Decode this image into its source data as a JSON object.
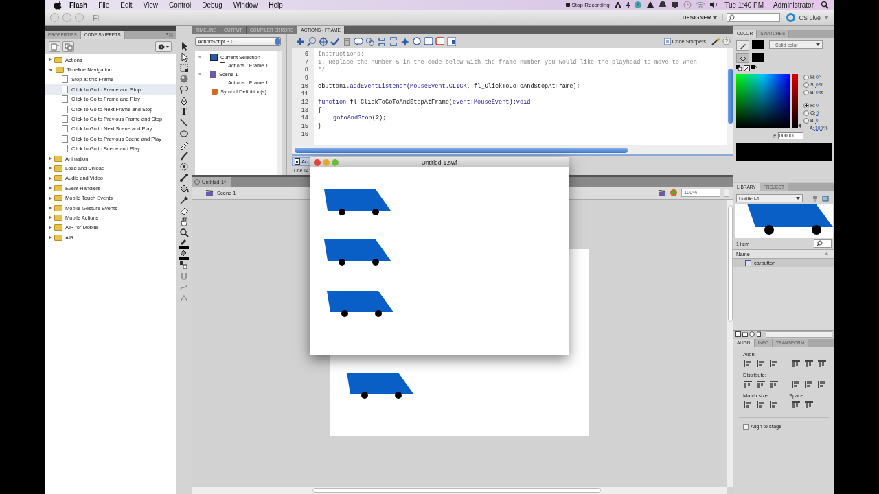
{
  "menu_bar": {
    "app": "Flash",
    "items": [
      "File",
      "Edit",
      "View",
      "Control",
      "Debug",
      "Window",
      "Help"
    ],
    "recording": "Stop Recording",
    "adobe_count": "4",
    "clock": "Tue 1:40 PM",
    "user": "Administrator"
  },
  "title_bar": {
    "logo": "Fl",
    "workspace": "DESIGNER",
    "cs_live": "CS Live"
  },
  "left_panel": {
    "tabs": [
      {
        "label": "PROPERTIES",
        "selected": false
      },
      {
        "label": "CODE SNIPPETS",
        "selected": true
      }
    ],
    "tree": [
      {
        "label": "Actions",
        "expanded": false,
        "selected": false
      },
      {
        "label": "Timeline Navigation",
        "expanded": true,
        "selected": false,
        "children": [
          {
            "label": "Stop at this Frame",
            "selected": false
          },
          {
            "label": "Click to Go to Frame and Stop",
            "selected": true
          },
          {
            "label": "Click to Go to Frame and Play",
            "selected": false
          },
          {
            "label": "Click to Go to Next Frame and Stop",
            "selected": false
          },
          {
            "label": "Click to Go to Previous Frame and Stop",
            "selected": false
          },
          {
            "label": "Click to Go to Next Scene and Play",
            "selected": false
          },
          {
            "label": "Click to Go to Previous Scene and Play",
            "selected": false
          },
          {
            "label": "Click to Go to Scene and Play",
            "selected": false
          }
        ]
      },
      {
        "label": "Animation",
        "expanded": false,
        "selected": false
      },
      {
        "label": "Load and Unload",
        "expanded": false,
        "selected": false
      },
      {
        "label": "Audio and Video",
        "expanded": false,
        "selected": false
      },
      {
        "label": "Event Handlers",
        "expanded": false,
        "selected": false
      },
      {
        "label": "Mobile Touch Events",
        "expanded": false,
        "selected": false
      },
      {
        "label": "Mobile Gesture Events",
        "expanded": false,
        "selected": false
      },
      {
        "label": "Mobile Actions",
        "expanded": false,
        "selected": false
      },
      {
        "label": "AIR for Mobile",
        "expanded": false,
        "selected": false
      },
      {
        "label": "AIR",
        "expanded": false,
        "selected": false
      }
    ]
  },
  "tools": {
    "text_tool_glyph": "T"
  },
  "actions_panel": {
    "tabs": [
      {
        "label": "TIMELINE",
        "selected": false
      },
      {
        "label": "OUTPUT",
        "selected": false
      },
      {
        "label": "COMPILER ERRORS",
        "selected": false
      },
      {
        "label": "ACTIONS - FRAME",
        "selected": true
      }
    ],
    "language": "ActionScript 3.0",
    "navigator": [
      {
        "label": "Current Selection",
        "kind": "selection",
        "expanded": true,
        "children": [
          {
            "label": "Actions : Frame 1"
          }
        ]
      },
      {
        "label": "Scene 1",
        "kind": "scene",
        "expanded": true,
        "children": [
          {
            "label": "Actions : Frame 1"
          }
        ]
      },
      {
        "label": "Symbol Definition(s)",
        "kind": "symbols"
      }
    ],
    "code_snippets_button": "Code Snippets",
    "code_lines": [
      {
        "number": "6",
        "tokens": [
          {
            "text": "Instructions:",
            "kind": "comment"
          }
        ]
      },
      {
        "number": "7",
        "tokens": [
          {
            "text": "1. Replace the number 5 in the code below with the frame number you would like the playhead to move to when",
            "kind": "comment"
          }
        ]
      },
      {
        "number": "8",
        "tokens": [
          {
            "text": "*/",
            "kind": "comment"
          }
        ]
      },
      {
        "number": "9"
      },
      {
        "number": "10",
        "tokens": [
          {
            "text": "cbutton1.",
            "kind": "plain"
          },
          {
            "text": "addEventListener",
            "kind": "keyword"
          },
          {
            "text": "(",
            "kind": "plain"
          },
          {
            "text": "MouseEvent.CLICK",
            "kind": "keyword"
          },
          {
            "text": ", fl_ClickToGoToAndStopAtFrame);",
            "kind": "plain"
          }
        ]
      },
      {
        "number": "11"
      },
      {
        "number": "12",
        "tokens": [
          {
            "text": "function",
            "kind": "keyword"
          },
          {
            "text": " fl_ClickToGoToAndStopAtFrame(",
            "kind": "plain"
          },
          {
            "text": "event:MouseEvent",
            "kind": "keyword"
          },
          {
            "text": "):",
            "kind": "plain"
          },
          {
            "text": "void",
            "kind": "keyword"
          }
        ]
      },
      {
        "number": "13",
        "tokens": [
          {
            "text": "{",
            "kind": "plain"
          }
        ]
      },
      {
        "number": "14",
        "indented": true,
        "tokens": [
          {
            "text": "gotoAndStop",
            "kind": "keyword"
          },
          {
            "text": "(2);",
            "kind": "plain"
          }
        ]
      },
      {
        "number": "15",
        "tokens": [
          {
            "text": "}",
            "kind": "plain"
          }
        ]
      },
      {
        "number": "16"
      }
    ],
    "bottom_tab": "Act",
    "status": "Line 14"
  },
  "document": {
    "tab": "Untitled-1*",
    "scene": "Scene 1",
    "zoom": "100%"
  },
  "swf_window": {
    "title": "Untitled-1.swf"
  },
  "color_panel": {
    "tabs": [
      {
        "label": "COLOR",
        "selected": true
      },
      {
        "label": "SWATCHES",
        "selected": false
      }
    ],
    "type": "Solid color",
    "fields": [
      {
        "label": "H:",
        "value": "0",
        "unit": "°",
        "selected": false
      },
      {
        "label": "S:",
        "value": "0",
        "unit": "%",
        "selected": false
      },
      {
        "label": "B:",
        "value": "0",
        "unit": "%",
        "selected": false
      },
      {
        "label": "R:",
        "value": "0",
        "selected": true
      },
      {
        "label": "G:",
        "value": "0",
        "selected": false
      },
      {
        "label": "B:",
        "value": "0",
        "selected": false
      }
    ],
    "brightness_slider": {
      "level": 0
    },
    "alpha_label": "A:",
    "alpha": "100",
    "alpha_unit": "%",
    "hex_label": "#",
    "hex": "000000"
  },
  "library_panel": {
    "tabs": [
      {
        "label": "LIBRARY",
        "selected": true
      },
      {
        "label": "PROJECT",
        "selected": false
      }
    ],
    "document": "Untitled-1",
    "count": "1 item",
    "column": "Name",
    "items": [
      {
        "name": "carbutton"
      }
    ]
  },
  "align_panel": {
    "tabs": [
      {
        "label": "ALIGN",
        "selected": true
      },
      {
        "label": "INFO",
        "selected": false
      },
      {
        "label": "TRANSFORM",
        "selected": false
      }
    ],
    "align_label": "Align:",
    "distribute_label": "Distribute:",
    "match_label": "Match size:",
    "space_label": "Space:",
    "align_to_stage": {
      "label": "Align to stage",
      "checked": false
    }
  }
}
